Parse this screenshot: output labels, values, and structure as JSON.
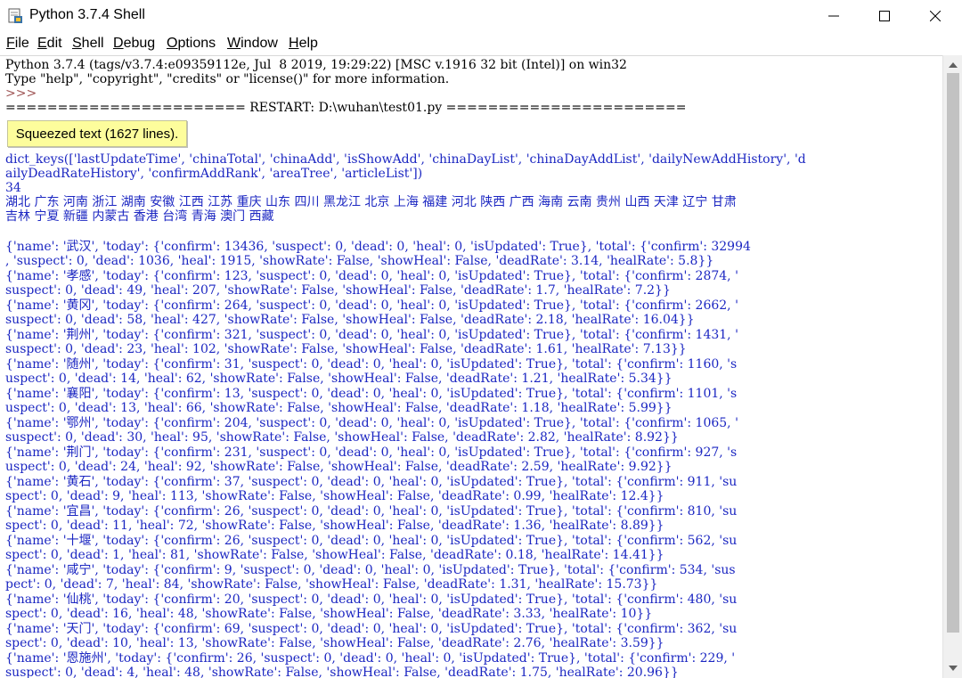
{
  "window": {
    "title": "Python 3.7.4 Shell",
    "icon": "python-idle-icon",
    "controls": [
      "minimize-icon",
      "maximize-icon",
      "close-icon"
    ]
  },
  "menu": {
    "file": "File",
    "edit": "Edit",
    "shell": "Shell",
    "debug": "Debug",
    "options": "Options",
    "window": "Window",
    "help": "Help"
  },
  "colors": {
    "output_blue": "#1c27c2",
    "prompt": "#9c5050",
    "squeezed_bg": "#fdfd9c"
  },
  "shell": {
    "banner1": "Python 3.7.4 (tags/v3.7.4:e09359112e, Jul  8 2019, 19:29:22) [MSC v.1916 32 bit (Intel)] on win32",
    "banner2": "Type \"help\", \"copyright\", \"credits\" or \"license()\" for more information.",
    "prompt": ">>>",
    "restart": "======================= RESTART: D:\\wuhan\\test01.py =======================",
    "squeezed_label": "Squeezed text (1627 lines).",
    "output": [
      "dict_keys(['lastUpdateTime', 'chinaTotal', 'chinaAdd', 'isShowAdd', 'chinaDayList', 'chinaDayAddList', 'dailyNewAddHistory', 'd",
      "ailyDeadRateHistory', 'confirmAddRank', 'areaTree', 'articleList'])",
      "34",
      "湖北 广东 河南 浙江 湖南 安徽 江西 江苏 重庆 山东 四川 黑龙江 北京 上海 福建 河北 陕西 广西 海南 云南 贵州 山西 天津 辽宁 甘肃",
      "吉林 宁夏 新疆 内蒙古 香港 台湾 青海 澳门 西藏",
      "",
      "{'name': '武汉', 'today': {'confirm': 13436, 'suspect': 0, 'dead': 0, 'heal': 0, 'isUpdated': True}, 'total': {'confirm': 32994",
      ", 'suspect': 0, 'dead': 1036, 'heal': 1915, 'showRate': False, 'showHeal': False, 'deadRate': 3.14, 'healRate': 5.8}}",
      "{'name': '孝感', 'today': {'confirm': 123, 'suspect': 0, 'dead': 0, 'heal': 0, 'isUpdated': True}, 'total': {'confirm': 2874, '",
      "suspect': 0, 'dead': 49, 'heal': 207, 'showRate': False, 'showHeal': False, 'deadRate': 1.7, 'healRate': 7.2}}",
      "{'name': '黄冈', 'today': {'confirm': 264, 'suspect': 0, 'dead': 0, 'heal': 0, 'isUpdated': True}, 'total': {'confirm': 2662, '",
      "suspect': 0, 'dead': 58, 'heal': 427, 'showRate': False, 'showHeal': False, 'deadRate': 2.18, 'healRate': 16.04}}",
      "{'name': '荆州', 'today': {'confirm': 321, 'suspect': 0, 'dead': 0, 'heal': 0, 'isUpdated': True}, 'total': {'confirm': 1431, '",
      "suspect': 0, 'dead': 23, 'heal': 102, 'showRate': False, 'showHeal': False, 'deadRate': 1.61, 'healRate': 7.13}}",
      "{'name': '随州', 'today': {'confirm': 31, 'suspect': 0, 'dead': 0, 'heal': 0, 'isUpdated': True}, 'total': {'confirm': 1160, 's",
      "uspect': 0, 'dead': 14, 'heal': 62, 'showRate': False, 'showHeal': False, 'deadRate': 1.21, 'healRate': 5.34}}",
      "{'name': '襄阳', 'today': {'confirm': 13, 'suspect': 0, 'dead': 0, 'heal': 0, 'isUpdated': True}, 'total': {'confirm': 1101, 's",
      "uspect': 0, 'dead': 13, 'heal': 66, 'showRate': False, 'showHeal': False, 'deadRate': 1.18, 'healRate': 5.99}}",
      "{'name': '鄂州', 'today': {'confirm': 204, 'suspect': 0, 'dead': 0, 'heal': 0, 'isUpdated': True}, 'total': {'confirm': 1065, '",
      "suspect': 0, 'dead': 30, 'heal': 95, 'showRate': False, 'showHeal': False, 'deadRate': 2.82, 'healRate': 8.92}}",
      "{'name': '荆门', 'today': {'confirm': 231, 'suspect': 0, 'dead': 0, 'heal': 0, 'isUpdated': True}, 'total': {'confirm': 927, 's",
      "uspect': 0, 'dead': 24, 'heal': 92, 'showRate': False, 'showHeal': False, 'deadRate': 2.59, 'healRate': 9.92}}",
      "{'name': '黄石', 'today': {'confirm': 37, 'suspect': 0, 'dead': 0, 'heal': 0, 'isUpdated': True}, 'total': {'confirm': 911, 'su",
      "spect': 0, 'dead': 9, 'heal': 113, 'showRate': False, 'showHeal': False, 'deadRate': 0.99, 'healRate': 12.4}}",
      "{'name': '宜昌', 'today': {'confirm': 26, 'suspect': 0, 'dead': 0, 'heal': 0, 'isUpdated': True}, 'total': {'confirm': 810, 'su",
      "spect': 0, 'dead': 11, 'heal': 72, 'showRate': False, 'showHeal': False, 'deadRate': 1.36, 'healRate': 8.89}}",
      "{'name': '十堰', 'today': {'confirm': 26, 'suspect': 0, 'dead': 0, 'heal': 0, 'isUpdated': True}, 'total': {'confirm': 562, 'su",
      "spect': 0, 'dead': 1, 'heal': 81, 'showRate': False, 'showHeal': False, 'deadRate': 0.18, 'healRate': 14.41}}",
      "{'name': '咸宁', 'today': {'confirm': 9, 'suspect': 0, 'dead': 0, 'heal': 0, 'isUpdated': True}, 'total': {'confirm': 534, 'sus",
      "pect': 0, 'dead': 7, 'heal': 84, 'showRate': False, 'showHeal': False, 'deadRate': 1.31, 'healRate': 15.73}}",
      "{'name': '仙桃', 'today': {'confirm': 20, 'suspect': 0, 'dead': 0, 'heal': 0, 'isUpdated': True}, 'total': {'confirm': 480, 'su",
      "spect': 0, 'dead': 16, 'heal': 48, 'showRate': False, 'showHeal': False, 'deadRate': 3.33, 'healRate': 10}}",
      "{'name': '天门', 'today': {'confirm': 69, 'suspect': 0, 'dead': 0, 'heal': 0, 'isUpdated': True}, 'total': {'confirm': 362, 'su",
      "spect': 0, 'dead': 10, 'heal': 13, 'showRate': False, 'showHeal': False, 'deadRate': 2.76, 'healRate': 3.59}}",
      "{'name': '恩施州', 'today': {'confirm': 26, 'suspect': 0, 'dead': 0, 'heal': 0, 'isUpdated': True}, 'total': {'confirm': 229, '",
      "suspect': 0, 'dead': 4, 'heal': 48, 'showRate': False, 'showHeal': False, 'deadRate': 1.75, 'healRate': 20.96}}"
    ]
  }
}
